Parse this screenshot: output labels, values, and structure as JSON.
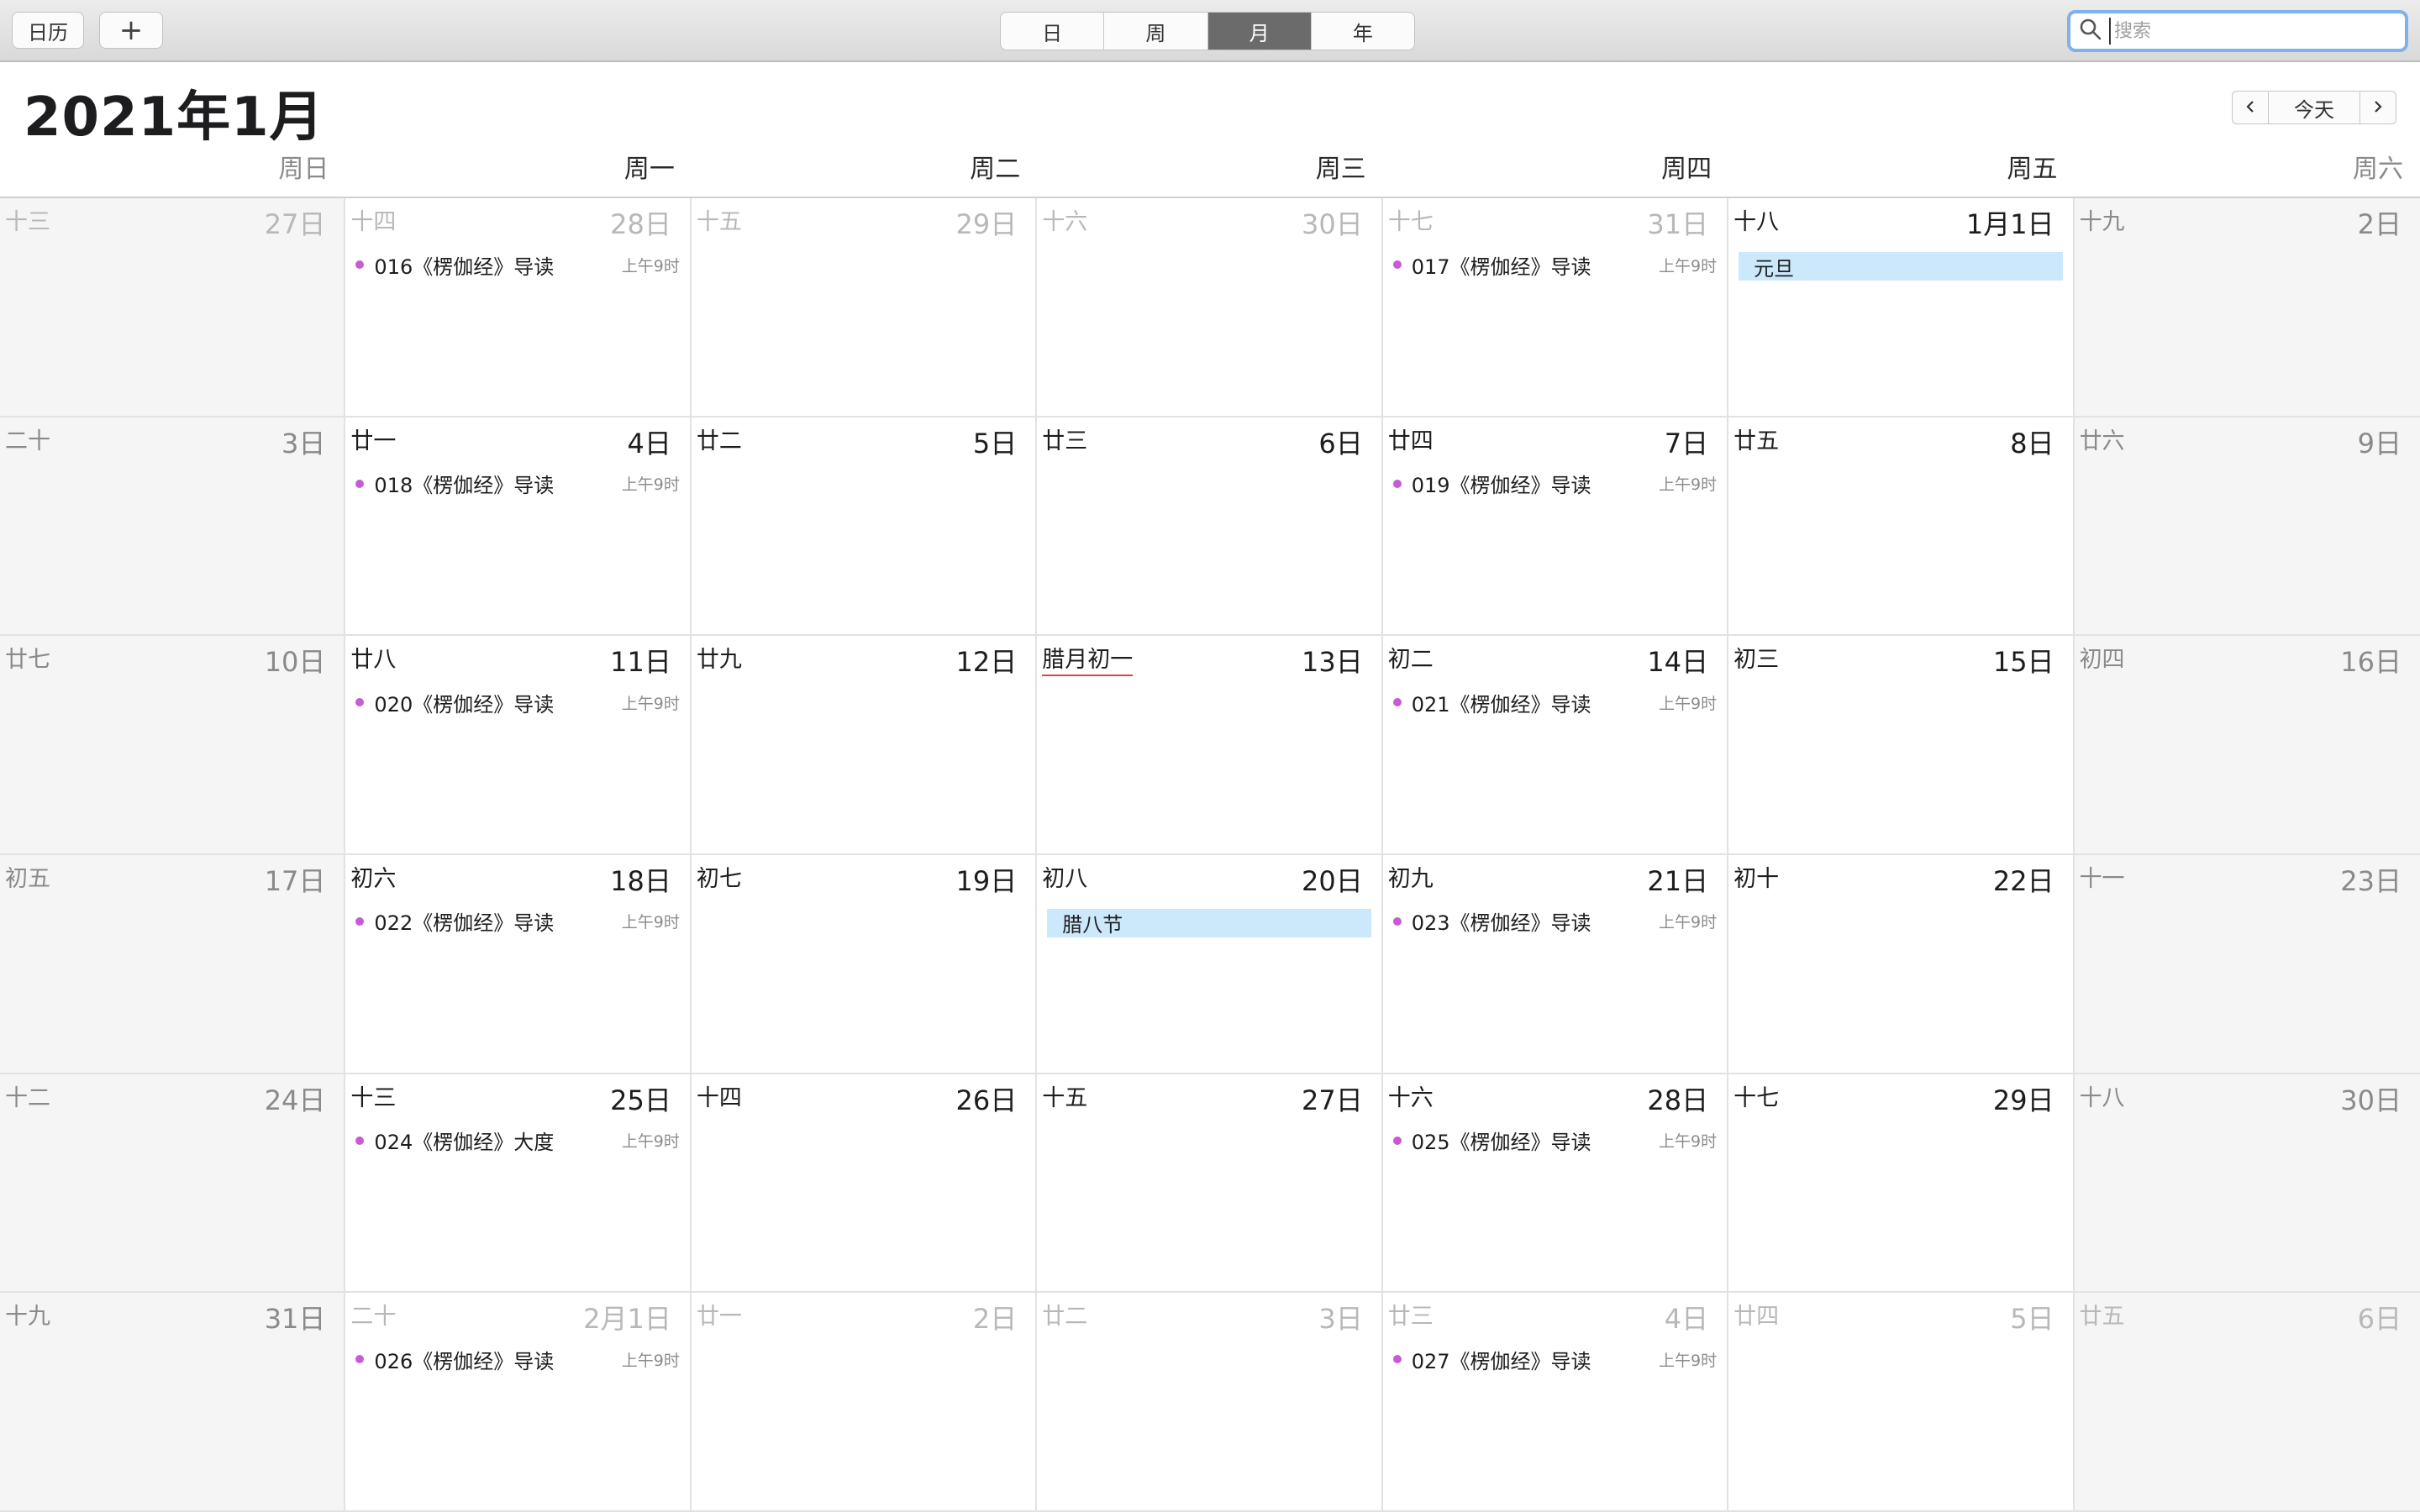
{
  "toolbar": {
    "calendars_label": "日历",
    "add_label": "+",
    "views": [
      "日",
      "周",
      "月",
      "年"
    ],
    "active_view": "月",
    "search_placeholder": "搜索"
  },
  "header": {
    "month_title": "2021年1月",
    "today_label": "今天"
  },
  "weekdays": [
    "周日",
    "周一",
    "周二",
    "周三",
    "周四",
    "周五",
    "周六"
  ],
  "colors": {
    "event_dot": "#c95ad6",
    "holiday_bg": "#cce8fb",
    "festival_underline": "#e0443c",
    "active_segment": "#6b6b6b"
  },
  "weeks": [
    {
      "days": [
        {
          "lunar": "十三",
          "solar": "27日",
          "other": true
        },
        {
          "lunar": "十四",
          "solar": "28日",
          "other": true,
          "event": {
            "title": "016《楞伽经》导读",
            "time": "上午9时"
          }
        },
        {
          "lunar": "十五",
          "solar": "29日",
          "other": true
        },
        {
          "lunar": "十六",
          "solar": "30日",
          "other": true
        },
        {
          "lunar": "十七",
          "solar": "31日",
          "other": true,
          "event": {
            "title": "017《楞伽经》导读",
            "time": "上午9时"
          }
        },
        {
          "lunar": "十八",
          "solar": "1月1日",
          "holiday": "元旦"
        },
        {
          "lunar": "十九",
          "solar": "2日"
        }
      ]
    },
    {
      "days": [
        {
          "lunar": "二十",
          "solar": "3日"
        },
        {
          "lunar": "廿一",
          "solar": "4日",
          "event": {
            "title": "018《楞伽经》导读",
            "time": "上午9时"
          }
        },
        {
          "lunar": "廿二",
          "solar": "5日"
        },
        {
          "lunar": "廿三",
          "solar": "6日"
        },
        {
          "lunar": "廿四",
          "solar": "7日",
          "event": {
            "title": "019《楞伽经》导读",
            "time": "上午9时"
          }
        },
        {
          "lunar": "廿五",
          "solar": "8日"
        },
        {
          "lunar": "廿六",
          "solar": "9日"
        }
      ]
    },
    {
      "days": [
        {
          "lunar": "廿七",
          "solar": "10日"
        },
        {
          "lunar": "廿八",
          "solar": "11日",
          "event": {
            "title": "020《楞伽经》导读",
            "time": "上午9时"
          }
        },
        {
          "lunar": "廿九",
          "solar": "12日"
        },
        {
          "lunar": "腊月初一",
          "solar": "13日",
          "festival": true
        },
        {
          "lunar": "初二",
          "solar": "14日",
          "event": {
            "title": "021《楞伽经》导读",
            "time": "上午9时"
          }
        },
        {
          "lunar": "初三",
          "solar": "15日"
        },
        {
          "lunar": "初四",
          "solar": "16日"
        }
      ]
    },
    {
      "days": [
        {
          "lunar": "初五",
          "solar": "17日"
        },
        {
          "lunar": "初六",
          "solar": "18日",
          "event": {
            "title": "022《楞伽经》导读",
            "time": "上午9时"
          }
        },
        {
          "lunar": "初七",
          "solar": "19日"
        },
        {
          "lunar": "初八",
          "solar": "20日",
          "holiday": "腊八节"
        },
        {
          "lunar": "初九",
          "solar": "21日",
          "event": {
            "title": "023《楞伽经》导读",
            "time": "上午9时"
          }
        },
        {
          "lunar": "初十",
          "solar": "22日"
        },
        {
          "lunar": "十一",
          "solar": "23日"
        }
      ]
    },
    {
      "days": [
        {
          "lunar": "十二",
          "solar": "24日"
        },
        {
          "lunar": "十三",
          "solar": "25日",
          "event": {
            "title": "024《楞伽经》大度",
            "time": "上午9时"
          }
        },
        {
          "lunar": "十四",
          "solar": "26日"
        },
        {
          "lunar": "十五",
          "solar": "27日"
        },
        {
          "lunar": "十六",
          "solar": "28日",
          "event": {
            "title": "025《楞伽经》导读",
            "time": "上午9时"
          }
        },
        {
          "lunar": "十七",
          "solar": "29日"
        },
        {
          "lunar": "十八",
          "solar": "30日"
        }
      ]
    },
    {
      "days": [
        {
          "lunar": "十九",
          "solar": "31日"
        },
        {
          "lunar": "二十",
          "solar": "2月1日",
          "other": true,
          "event": {
            "title": "026《楞伽经》导读",
            "time": "上午9时"
          }
        },
        {
          "lunar": "廿一",
          "solar": "2日",
          "other": true
        },
        {
          "lunar": "廿二",
          "solar": "3日",
          "other": true
        },
        {
          "lunar": "廿三",
          "solar": "4日",
          "other": true,
          "event": {
            "title": "027《楞伽经》导读",
            "time": "上午9时"
          }
        },
        {
          "lunar": "廿四",
          "solar": "5日",
          "other": true
        },
        {
          "lunar": "廿五",
          "solar": "6日",
          "other": true
        }
      ]
    }
  ]
}
